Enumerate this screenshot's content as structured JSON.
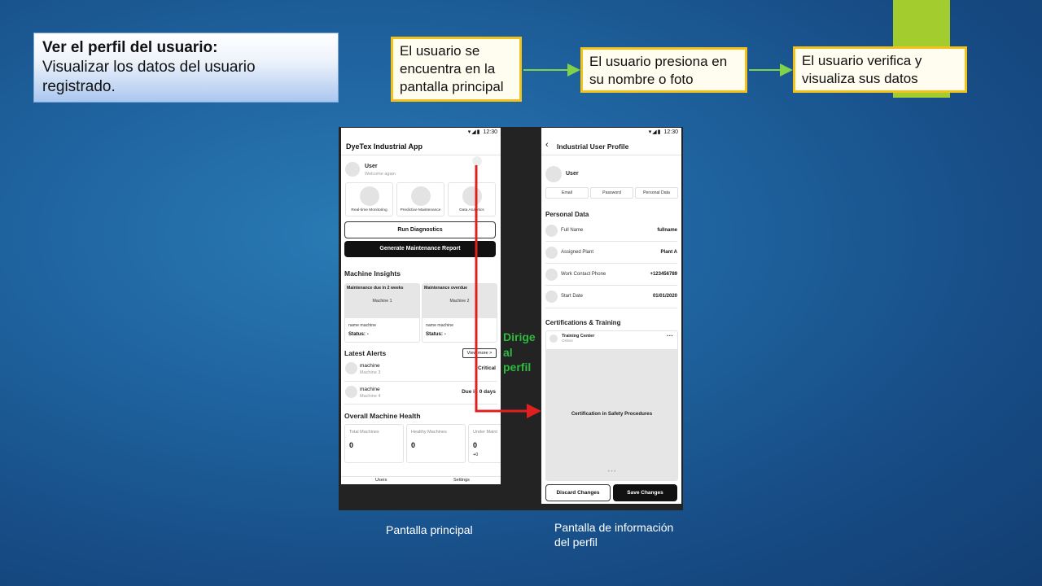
{
  "colors": {
    "background": "#1f64a0",
    "accent_bar": "#a3cc2f",
    "flow_border": "#f2c21b",
    "flow_arrow": "#7fd24a",
    "red_arrow": "#e02020",
    "note_green": "#2dbb3e"
  },
  "title_box": {
    "heading": "Ver el perfil del usuario:",
    "body": "Visualizar los datos del usuario registrado."
  },
  "flow": [
    {
      "text": "El usuario se encuentra en la pantalla principal"
    },
    {
      "text": "El usuario presiona en su nombre o foto"
    },
    {
      "text": "El usuario verifica y visualiza sus datos"
    }
  ],
  "note": "Dirige al perfil",
  "captions": {
    "left": "Pantalla principal",
    "right": "Pantalla de información del perfil"
  },
  "home_screen": {
    "status_time": "12:30",
    "app_title": "DyeTex Industrial App",
    "user_name": "User",
    "user_greeting": "Welcome again",
    "feature_cards": [
      "Real-time Monitoring",
      "Predictive Maintenance",
      "Data Analytics"
    ],
    "run_diagnostics": "Run Diagnostics",
    "generate_report": "Generate Maintenance Report",
    "insights_title": "Machine Insights",
    "machine_cards": [
      {
        "tag": "Maintenance due in 2 weeks",
        "machine": "Machine 1",
        "name_label": "name machine",
        "status": "Status: -"
      },
      {
        "tag": "Maintenance overdue",
        "machine": "Machine 2",
        "name_label": "name machine",
        "status": "Status: -"
      }
    ],
    "alerts_title": "Latest Alerts",
    "view_more": "View more",
    "alerts": [
      {
        "title": "machine",
        "sub": "Machine 3",
        "value": "Critical"
      },
      {
        "title": "machine",
        "sub": "Machine 4",
        "value": "Due in 0 days"
      }
    ],
    "health_title": "Overall Machine Health",
    "health": [
      {
        "label": "Total Machines",
        "value": "0",
        "extra": ""
      },
      {
        "label": "Healthy Machines",
        "value": "0",
        "extra": ""
      },
      {
        "label": "Under Maint",
        "value": "0",
        "extra": "+0"
      }
    ],
    "bottom_nav": [
      "Users",
      "Settings"
    ]
  },
  "profile_screen": {
    "status_time": "12:30",
    "back_icon": "chevron-left-icon",
    "title": "Industrial User Profile",
    "user_name": "User",
    "segments": [
      "Email",
      "Password",
      "Personal Data"
    ],
    "personal_title": "Personal Data",
    "fields": [
      {
        "label": "Full Name",
        "value": "fullname"
      },
      {
        "label": "Assigned Plant",
        "value": "Plant A"
      },
      {
        "label": "Work Contact Phone",
        "value": "+123456789"
      },
      {
        "label": "Start Date",
        "value": "01/01/2020"
      }
    ],
    "cert_title": "Certifications & Training",
    "training_center": "Training Center",
    "training_sub": "Online",
    "more_icon": "more-horizontal-icon",
    "cert_name": "Certification in Safety Procedures",
    "discard": "Discard Changes",
    "save": "Save Changes"
  }
}
